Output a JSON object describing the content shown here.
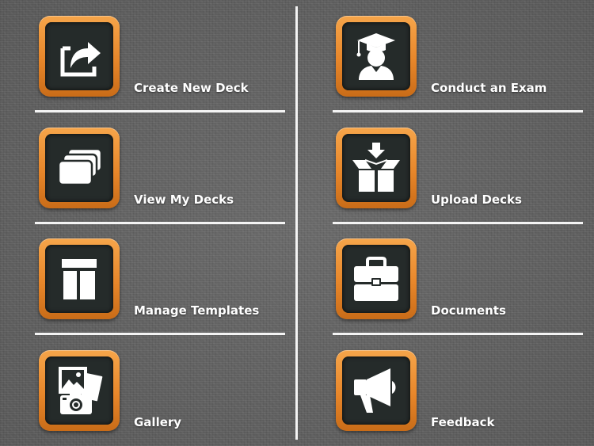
{
  "theme": {
    "accent": "#e8892c",
    "tile_inner": "#252b2a",
    "text": "#ffffff",
    "divider": "#f4f4f4"
  },
  "menu": {
    "left": [
      {
        "label": "Create New Deck",
        "icon": "share-export-icon"
      },
      {
        "label": "View My Decks",
        "icon": "card-stack-icon"
      },
      {
        "label": "Manage Templates",
        "icon": "template-layout-icon"
      },
      {
        "label": "Gallery",
        "icon": "photo-camera-icon"
      }
    ],
    "right": [
      {
        "label": "Conduct an Exam",
        "icon": "graduate-icon"
      },
      {
        "label": "Upload Decks",
        "icon": "box-download-icon"
      },
      {
        "label": "Documents",
        "icon": "briefcase-icon"
      },
      {
        "label": "Feedback",
        "icon": "megaphone-icon"
      }
    ]
  }
}
